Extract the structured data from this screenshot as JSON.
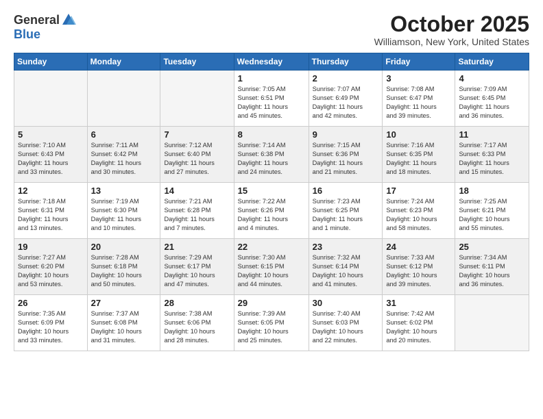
{
  "logo": {
    "general": "General",
    "blue": "Blue"
  },
  "header": {
    "month": "October 2025",
    "location": "Williamson, New York, United States"
  },
  "weekdays": [
    "Sunday",
    "Monday",
    "Tuesday",
    "Wednesday",
    "Thursday",
    "Friday",
    "Saturday"
  ],
  "weeks": [
    {
      "shaded": false,
      "days": [
        {
          "num": "",
          "info": ""
        },
        {
          "num": "",
          "info": ""
        },
        {
          "num": "",
          "info": ""
        },
        {
          "num": "1",
          "info": "Sunrise: 7:05 AM\nSunset: 6:51 PM\nDaylight: 11 hours\nand 45 minutes."
        },
        {
          "num": "2",
          "info": "Sunrise: 7:07 AM\nSunset: 6:49 PM\nDaylight: 11 hours\nand 42 minutes."
        },
        {
          "num": "3",
          "info": "Sunrise: 7:08 AM\nSunset: 6:47 PM\nDaylight: 11 hours\nand 39 minutes."
        },
        {
          "num": "4",
          "info": "Sunrise: 7:09 AM\nSunset: 6:45 PM\nDaylight: 11 hours\nand 36 minutes."
        }
      ]
    },
    {
      "shaded": true,
      "days": [
        {
          "num": "5",
          "info": "Sunrise: 7:10 AM\nSunset: 6:43 PM\nDaylight: 11 hours\nand 33 minutes."
        },
        {
          "num": "6",
          "info": "Sunrise: 7:11 AM\nSunset: 6:42 PM\nDaylight: 11 hours\nand 30 minutes."
        },
        {
          "num": "7",
          "info": "Sunrise: 7:12 AM\nSunset: 6:40 PM\nDaylight: 11 hours\nand 27 minutes."
        },
        {
          "num": "8",
          "info": "Sunrise: 7:14 AM\nSunset: 6:38 PM\nDaylight: 11 hours\nand 24 minutes."
        },
        {
          "num": "9",
          "info": "Sunrise: 7:15 AM\nSunset: 6:36 PM\nDaylight: 11 hours\nand 21 minutes."
        },
        {
          "num": "10",
          "info": "Sunrise: 7:16 AM\nSunset: 6:35 PM\nDaylight: 11 hours\nand 18 minutes."
        },
        {
          "num": "11",
          "info": "Sunrise: 7:17 AM\nSunset: 6:33 PM\nDaylight: 11 hours\nand 15 minutes."
        }
      ]
    },
    {
      "shaded": false,
      "days": [
        {
          "num": "12",
          "info": "Sunrise: 7:18 AM\nSunset: 6:31 PM\nDaylight: 11 hours\nand 13 minutes."
        },
        {
          "num": "13",
          "info": "Sunrise: 7:19 AM\nSunset: 6:30 PM\nDaylight: 11 hours\nand 10 minutes."
        },
        {
          "num": "14",
          "info": "Sunrise: 7:21 AM\nSunset: 6:28 PM\nDaylight: 11 hours\nand 7 minutes."
        },
        {
          "num": "15",
          "info": "Sunrise: 7:22 AM\nSunset: 6:26 PM\nDaylight: 11 hours\nand 4 minutes."
        },
        {
          "num": "16",
          "info": "Sunrise: 7:23 AM\nSunset: 6:25 PM\nDaylight: 11 hours\nand 1 minute."
        },
        {
          "num": "17",
          "info": "Sunrise: 7:24 AM\nSunset: 6:23 PM\nDaylight: 10 hours\nand 58 minutes."
        },
        {
          "num": "18",
          "info": "Sunrise: 7:25 AM\nSunset: 6:21 PM\nDaylight: 10 hours\nand 55 minutes."
        }
      ]
    },
    {
      "shaded": true,
      "days": [
        {
          "num": "19",
          "info": "Sunrise: 7:27 AM\nSunset: 6:20 PM\nDaylight: 10 hours\nand 53 minutes."
        },
        {
          "num": "20",
          "info": "Sunrise: 7:28 AM\nSunset: 6:18 PM\nDaylight: 10 hours\nand 50 minutes."
        },
        {
          "num": "21",
          "info": "Sunrise: 7:29 AM\nSunset: 6:17 PM\nDaylight: 10 hours\nand 47 minutes."
        },
        {
          "num": "22",
          "info": "Sunrise: 7:30 AM\nSunset: 6:15 PM\nDaylight: 10 hours\nand 44 minutes."
        },
        {
          "num": "23",
          "info": "Sunrise: 7:32 AM\nSunset: 6:14 PM\nDaylight: 10 hours\nand 41 minutes."
        },
        {
          "num": "24",
          "info": "Sunrise: 7:33 AM\nSunset: 6:12 PM\nDaylight: 10 hours\nand 39 minutes."
        },
        {
          "num": "25",
          "info": "Sunrise: 7:34 AM\nSunset: 6:11 PM\nDaylight: 10 hours\nand 36 minutes."
        }
      ]
    },
    {
      "shaded": false,
      "days": [
        {
          "num": "26",
          "info": "Sunrise: 7:35 AM\nSunset: 6:09 PM\nDaylight: 10 hours\nand 33 minutes."
        },
        {
          "num": "27",
          "info": "Sunrise: 7:37 AM\nSunset: 6:08 PM\nDaylight: 10 hours\nand 31 minutes."
        },
        {
          "num": "28",
          "info": "Sunrise: 7:38 AM\nSunset: 6:06 PM\nDaylight: 10 hours\nand 28 minutes."
        },
        {
          "num": "29",
          "info": "Sunrise: 7:39 AM\nSunset: 6:05 PM\nDaylight: 10 hours\nand 25 minutes."
        },
        {
          "num": "30",
          "info": "Sunrise: 7:40 AM\nSunset: 6:03 PM\nDaylight: 10 hours\nand 22 minutes."
        },
        {
          "num": "31",
          "info": "Sunrise: 7:42 AM\nSunset: 6:02 PM\nDaylight: 10 hours\nand 20 minutes."
        },
        {
          "num": "",
          "info": ""
        }
      ]
    }
  ]
}
